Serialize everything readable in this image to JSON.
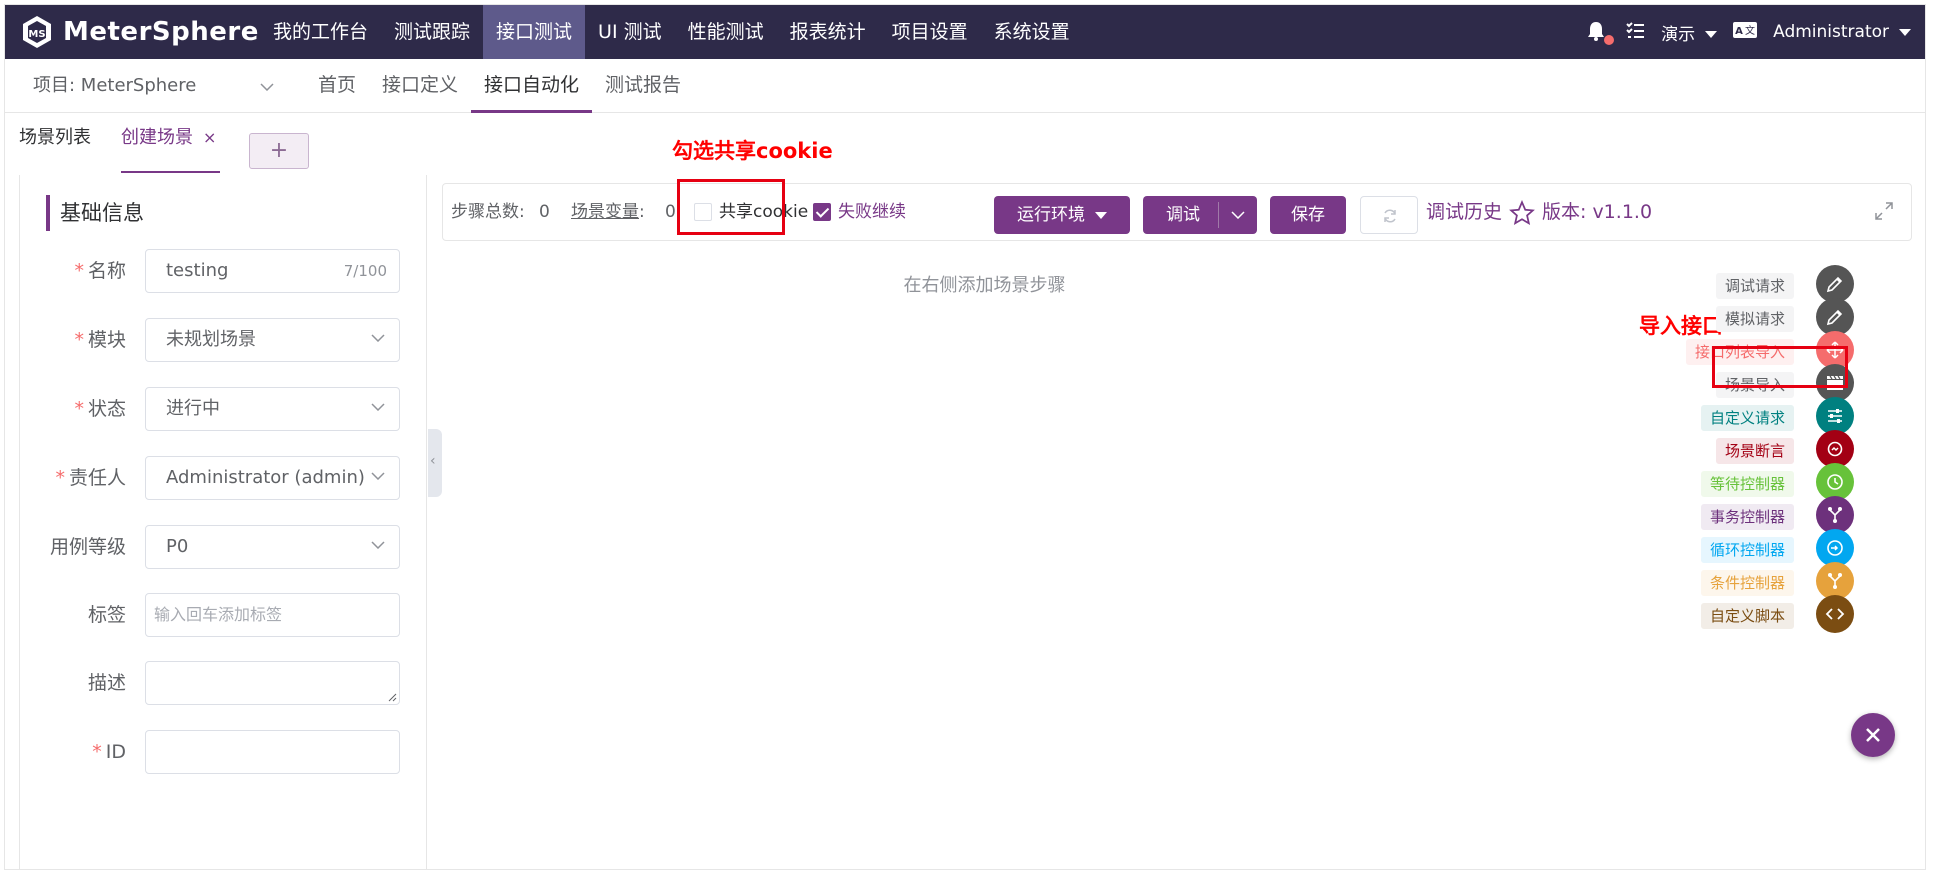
{
  "app": {
    "brand": "MeterSphere"
  },
  "topnav": {
    "items": [
      "我的工作台",
      "测试跟踪",
      "接口测试",
      "UI 测试",
      "性能测试",
      "报表统计",
      "项目设置",
      "系统设置"
    ],
    "active_index": 2
  },
  "topright": {
    "workspace": "演示",
    "lang_icon": "language-icon",
    "user": "Administrator"
  },
  "subnav": {
    "project": "项目: MeterSphere",
    "items": [
      "首页",
      "接口定义",
      "接口自动化",
      "测试报告"
    ],
    "active_index": 2
  },
  "tabs": {
    "list": "场景列表",
    "create": "创建场景",
    "close": "×",
    "add": "+"
  },
  "annotations": {
    "share_cookie": "勾选共享cookie",
    "import_api": "导入接口"
  },
  "form": {
    "section_title": "基础信息",
    "fields": {
      "name": {
        "label": "名称",
        "required": "*",
        "value": "testing",
        "count": "7/100"
      },
      "module": {
        "label": "模块",
        "required": "*",
        "value": "未规划场景"
      },
      "status": {
        "label": "状态",
        "required": "*",
        "value": "进行中"
      },
      "owner": {
        "label": "责任人",
        "required": "*",
        "value": "Administrator (admin)"
      },
      "level": {
        "label": "用例等级",
        "value": "P0"
      },
      "tags": {
        "label": "标签",
        "placeholder": "输入回车添加标签"
      },
      "desc": {
        "label": "描述",
        "value": ""
      },
      "id": {
        "label": "ID",
        "required": "*",
        "value": ""
      }
    }
  },
  "toolbar": {
    "step_total_label": "步骤总数:",
    "step_total": "0",
    "scene_var_label": "场景变量",
    "scene_var_sep": ":",
    "scene_var": "0",
    "share_cookie": "共享cookie",
    "share_cookie_checked": false,
    "continue_on_fail": "失败继续",
    "continue_on_fail_checked": true,
    "env_button": "运行环境",
    "debug_button": "调试",
    "save_button": "保存",
    "history": "调试历史",
    "version": "版本: v1.1.0"
  },
  "main": {
    "empty_hint": "在右侧添加场景步骤"
  },
  "step_menu": [
    {
      "label": "调试请求",
      "icon": "pencil-icon",
      "color": "#606266",
      "bg": "#f4f4f5",
      "icon_bg": "#555555"
    },
    {
      "label": "模拟请求",
      "icon": "pencil-icon",
      "color": "#606266",
      "bg": "#f4f4f5",
      "icon_bg": "#555555"
    },
    {
      "label": "接口列表导入",
      "icon": "move-icon",
      "color": "#f56c6c",
      "bg": "#fef0f0",
      "icon_bg": "#f56c6c"
    },
    {
      "label": "场景导入",
      "icon": "clapperboard-icon",
      "color": "#606266",
      "bg": "#f4f4f5",
      "icon_bg": "#555555"
    },
    {
      "label": "自定义请求",
      "icon": "sliders-icon",
      "color": "#008080",
      "bg": "#e6f2f2",
      "icon_bg": "#008080"
    },
    {
      "label": "场景断言",
      "icon": "assert-icon",
      "color": "#a30014",
      "bg": "#f6e6e8",
      "icon_bg": "#a30014"
    },
    {
      "label": "等待控制器",
      "icon": "clock-icon",
      "color": "#67c23a",
      "bg": "#f0f9eb",
      "icon_bg": "#67c23a"
    },
    {
      "label": "事务控制器",
      "icon": "branch-icon",
      "color": "#6d317c",
      "bg": "#f0eaf2",
      "icon_bg": "#6d317c"
    },
    {
      "label": "循环控制器",
      "icon": "loop-icon",
      "color": "#02a7f0",
      "bg": "#e6f6fe",
      "icon_bg": "#02a7f0"
    },
    {
      "label": "条件控制器",
      "icon": "branch-icon",
      "color": "#e6a23c",
      "bg": "#fdf6ec",
      "icon_bg": "#e6a23c"
    },
    {
      "label": "自定义脚本",
      "icon": "code-icon",
      "color": "#7b4d12",
      "bg": "#f2ede7",
      "icon_bg": "#7b4d12"
    }
  ],
  "colors": {
    "brand": "#783887",
    "header": "#2e2a49",
    "annotation": "#ff0000"
  }
}
